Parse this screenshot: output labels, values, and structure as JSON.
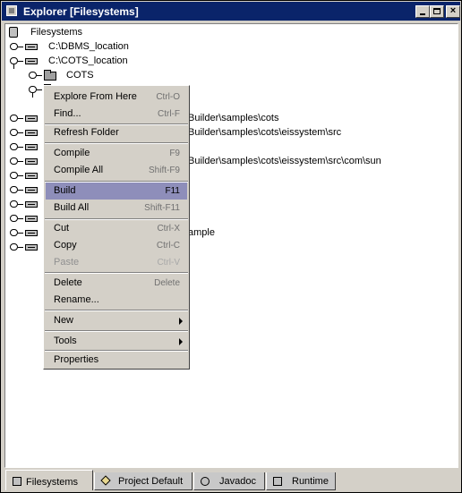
{
  "window": {
    "title": "Explorer [Filesystems]"
  },
  "tree": {
    "root": "Filesystems",
    "rows": [
      "C:\\DBMS_location",
      "C:\\COTS_location",
      "COTS",
      "",
      "Builder\\samples\\cots",
      "Builder\\samples\\cots\\eissystem\\src",
      "",
      "Builder\\samples\\cots\\eissystem\\src\\com\\sun",
      "",
      "",
      "",
      "",
      "ample",
      ""
    ]
  },
  "menu": {
    "items": [
      {
        "label": "Explore From Here",
        "shortcut": "Ctrl-O"
      },
      {
        "label": "Find...",
        "shortcut": "Ctrl-F"
      },
      {
        "label": "Refresh Folder",
        "shortcut": ""
      },
      {
        "label": "Compile",
        "shortcut": "F9"
      },
      {
        "label": "Compile All",
        "shortcut": "Shift-F9"
      },
      {
        "label": "Build",
        "shortcut": "F11"
      },
      {
        "label": "Build All",
        "shortcut": "Shift-F11"
      },
      {
        "label": "Cut",
        "shortcut": "Ctrl-X"
      },
      {
        "label": "Copy",
        "shortcut": "Ctrl-C"
      },
      {
        "label": "Paste",
        "shortcut": "Ctrl-V"
      },
      {
        "label": "Delete",
        "shortcut": "Delete"
      },
      {
        "label": "Rename...",
        "shortcut": ""
      },
      {
        "label": "New",
        "shortcut": ""
      },
      {
        "label": "Tools",
        "shortcut": ""
      },
      {
        "label": "Properties",
        "shortcut": ""
      }
    ]
  },
  "tabs": [
    {
      "label": "Filesystems"
    },
    {
      "label": "Project Default"
    },
    {
      "label": "Javadoc"
    },
    {
      "label": "Runtime"
    }
  ],
  "colors": {
    "titlebar": "#0a246a",
    "menu_highlight": "#8e8eba"
  }
}
